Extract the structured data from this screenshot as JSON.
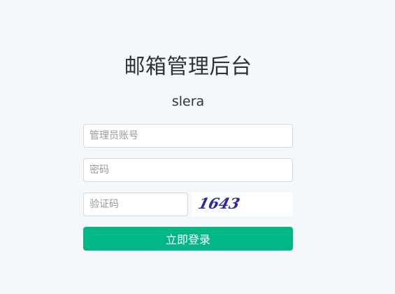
{
  "page": {
    "title": "邮箱管理后台",
    "subtitle": "slera"
  },
  "form": {
    "username_placeholder": "管理员账号",
    "username_value": "",
    "password_placeholder": "密码",
    "password_value": "",
    "captcha_placeholder": "验证码",
    "captcha_value": "",
    "captcha_image_text": "1643",
    "submit_label": "立即登录"
  },
  "colors": {
    "background": "#f4f8fb",
    "primary_button": "#00b886",
    "captcha_ink": "#2a2a9c"
  }
}
